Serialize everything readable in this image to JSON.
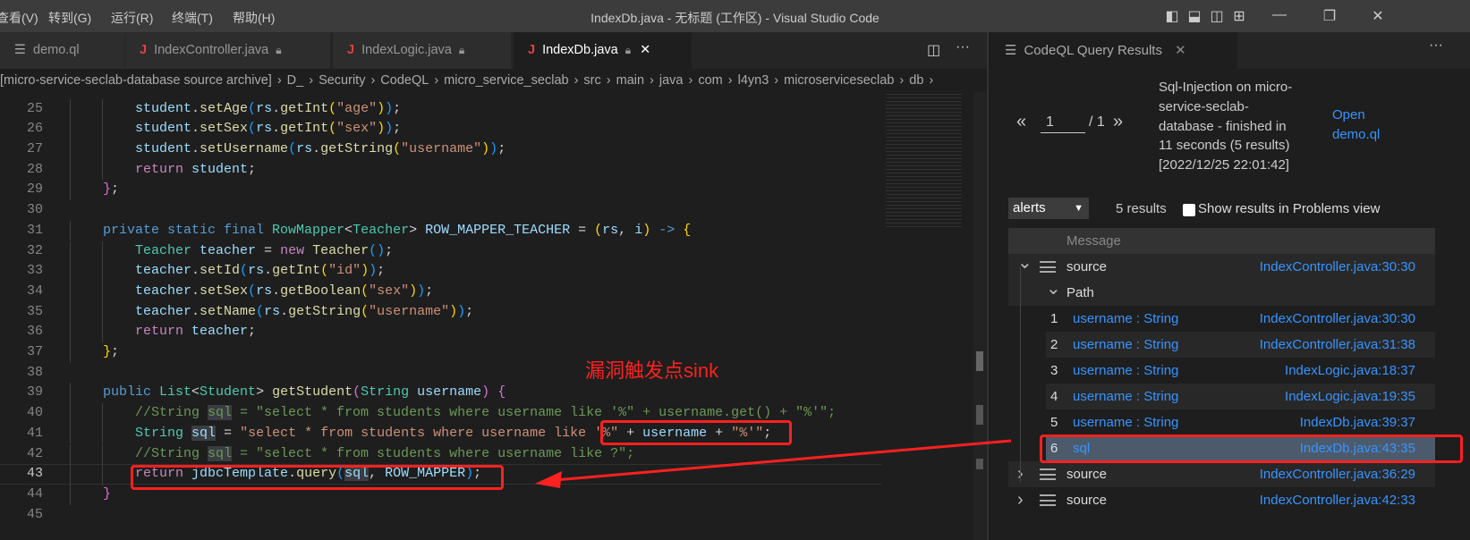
{
  "titlebar": {
    "menus": [
      "查看(V)",
      "转到(G)",
      "运行(R)",
      "终端(T)",
      "帮助(H)"
    ],
    "title": "IndexDb.java - 无标题 (工作区) - Visual Studio Code"
  },
  "tabs": [
    {
      "label": "demo.ql",
      "icon": "lines-icon",
      "locked": false,
      "active": false
    },
    {
      "label": "IndexController.java",
      "icon": "java-icon",
      "locked": true,
      "active": false
    },
    {
      "label": "IndexLogic.java",
      "icon": "java-icon",
      "locked": true,
      "active": false
    },
    {
      "label": "IndexDb.java",
      "icon": "java-icon",
      "locked": true,
      "active": true
    }
  ],
  "breadcrumb": [
    "[micro-service-seclab-database source archive]",
    "D_",
    "Security",
    "CodeQL",
    "micro_service_seclab",
    "src",
    "main",
    "java",
    "com",
    "l4yn3",
    "microserviceseclab",
    "db"
  ],
  "editor": {
    "current_line": 43,
    "lines": [
      {
        "n": 25,
        "indent": 2,
        "t": [
          [
            "va",
            "student"
          ],
          [
            "p",
            "."
          ],
          [
            "fn",
            "setAge"
          ],
          [
            "b3",
            "("
          ],
          [
            "va",
            "rs"
          ],
          [
            "p",
            "."
          ],
          [
            "fn",
            "getInt"
          ],
          [
            "b1",
            "("
          ],
          [
            "st",
            "\"age\""
          ],
          [
            "b1",
            ")"
          ],
          [
            "b3",
            ")"
          ],
          [
            "p",
            ";"
          ]
        ]
      },
      {
        "n": 26,
        "indent": 2,
        "t": [
          [
            "va",
            "student"
          ],
          [
            "p",
            "."
          ],
          [
            "fn",
            "setSex"
          ],
          [
            "b3",
            "("
          ],
          [
            "va",
            "rs"
          ],
          [
            "p",
            "."
          ],
          [
            "fn",
            "getInt"
          ],
          [
            "b1",
            "("
          ],
          [
            "st",
            "\"sex\""
          ],
          [
            "b1",
            ")"
          ],
          [
            "b3",
            ")"
          ],
          [
            "p",
            ";"
          ]
        ]
      },
      {
        "n": 27,
        "indent": 2,
        "t": [
          [
            "va",
            "student"
          ],
          [
            "p",
            "."
          ],
          [
            "fn",
            "setUsername"
          ],
          [
            "b3",
            "("
          ],
          [
            "va",
            "rs"
          ],
          [
            "p",
            "."
          ],
          [
            "fn",
            "getString"
          ],
          [
            "b1",
            "("
          ],
          [
            "st",
            "\"username\""
          ],
          [
            "b1",
            ")"
          ],
          [
            "b3",
            ")"
          ],
          [
            "p",
            ";"
          ]
        ]
      },
      {
        "n": 28,
        "indent": 2,
        "t": [
          [
            "ctl",
            "return"
          ],
          [
            "p",
            " "
          ],
          [
            "va",
            "student"
          ],
          [
            "p",
            ";"
          ]
        ]
      },
      {
        "n": 29,
        "indent": 1,
        "t": [
          [
            "b2",
            "}"
          ],
          [
            "p",
            ";"
          ]
        ]
      },
      {
        "n": 30,
        "indent": 0,
        "t": []
      },
      {
        "n": 31,
        "indent": 1,
        "t": [
          [
            "kw",
            "private static final "
          ],
          [
            "ty",
            "RowMapper"
          ],
          [
            "p",
            "<"
          ],
          [
            "ty",
            "Teacher"
          ],
          [
            "p",
            "> "
          ],
          [
            "va",
            "ROW_MAPPER_TEACHER"
          ],
          [
            "p",
            " = "
          ],
          [
            "b1",
            "("
          ],
          [
            "va",
            "rs"
          ],
          [
            "p",
            ", "
          ],
          [
            "va",
            "i"
          ],
          [
            "b1",
            ")"
          ],
          [
            "p",
            " "
          ],
          [
            "kw",
            "->"
          ],
          [
            "p",
            " "
          ],
          [
            "b1",
            "{"
          ]
        ]
      },
      {
        "n": 32,
        "indent": 2,
        "t": [
          [
            "ty",
            "Teacher"
          ],
          [
            "p",
            " "
          ],
          [
            "va",
            "teacher"
          ],
          [
            "p",
            " = "
          ],
          [
            "ctl",
            "new"
          ],
          [
            "p",
            " "
          ],
          [
            "fn",
            "Teacher"
          ],
          [
            "b3",
            "()"
          ],
          [
            "p",
            ";"
          ]
        ]
      },
      {
        "n": 33,
        "indent": 2,
        "t": [
          [
            "va",
            "teacher"
          ],
          [
            "p",
            "."
          ],
          [
            "fn",
            "setId"
          ],
          [
            "b3",
            "("
          ],
          [
            "va",
            "rs"
          ],
          [
            "p",
            "."
          ],
          [
            "fn",
            "getInt"
          ],
          [
            "b1",
            "("
          ],
          [
            "st",
            "\"id\""
          ],
          [
            "b1",
            ")"
          ],
          [
            "b3",
            ")"
          ],
          [
            "p",
            ";"
          ]
        ]
      },
      {
        "n": 34,
        "indent": 2,
        "t": [
          [
            "va",
            "teacher"
          ],
          [
            "p",
            "."
          ],
          [
            "fn",
            "setSex"
          ],
          [
            "b3",
            "("
          ],
          [
            "va",
            "rs"
          ],
          [
            "p",
            "."
          ],
          [
            "fn",
            "getBoolean"
          ],
          [
            "b1",
            "("
          ],
          [
            "st",
            "\"sex\""
          ],
          [
            "b1",
            ")"
          ],
          [
            "b3",
            ")"
          ],
          [
            "p",
            ";"
          ]
        ]
      },
      {
        "n": 35,
        "indent": 2,
        "t": [
          [
            "va",
            "teacher"
          ],
          [
            "p",
            "."
          ],
          [
            "fn",
            "setName"
          ],
          [
            "b3",
            "("
          ],
          [
            "va",
            "rs"
          ],
          [
            "p",
            "."
          ],
          [
            "fn",
            "getString"
          ],
          [
            "b1",
            "("
          ],
          [
            "st",
            "\"username\""
          ],
          [
            "b1",
            ")"
          ],
          [
            "b3",
            ")"
          ],
          [
            "p",
            ";"
          ]
        ]
      },
      {
        "n": 36,
        "indent": 2,
        "t": [
          [
            "ctl",
            "return"
          ],
          [
            "p",
            " "
          ],
          [
            "va",
            "teacher"
          ],
          [
            "p",
            ";"
          ]
        ]
      },
      {
        "n": 37,
        "indent": 1,
        "t": [
          [
            "b1",
            "}"
          ],
          [
            "p",
            ";"
          ]
        ]
      },
      {
        "n": 38,
        "indent": 0,
        "t": []
      },
      {
        "n": 39,
        "indent": 1,
        "t": [
          [
            "kw",
            "public "
          ],
          [
            "ty",
            "List"
          ],
          [
            "p",
            "<"
          ],
          [
            "ty",
            "Student"
          ],
          [
            "p",
            "> "
          ],
          [
            "fn",
            "getStudent"
          ],
          [
            "b2",
            "("
          ],
          [
            "ty",
            "String"
          ],
          [
            "p",
            " "
          ],
          [
            "va",
            "username"
          ],
          [
            "b2",
            ")"
          ],
          [
            "p",
            " "
          ],
          [
            "b2",
            "{"
          ]
        ]
      },
      {
        "n": 40,
        "indent": 2,
        "t": [
          [
            "cm",
            "//String "
          ],
          [
            "cm hl",
            "sql"
          ],
          [
            "cm",
            " = \"select * from students where username like '%\" + username.get() + \"%'\";"
          ]
        ]
      },
      {
        "n": 41,
        "indent": 2,
        "t": [
          [
            "ty",
            "String"
          ],
          [
            "p",
            " "
          ],
          [
            "va hl",
            "sql"
          ],
          [
            "p",
            " = "
          ],
          [
            "st",
            "\"select * from students where username like '%\""
          ],
          [
            "p",
            " + "
          ],
          [
            "va",
            "username"
          ],
          [
            "p",
            " + "
          ],
          [
            "st",
            "\"%'\""
          ],
          [
            "p",
            ";"
          ]
        ]
      },
      {
        "n": 42,
        "indent": 2,
        "t": [
          [
            "cm",
            "//String "
          ],
          [
            "cm hl",
            "sql"
          ],
          [
            "cm",
            " = \"select * from students where username like ?\";"
          ]
        ]
      },
      {
        "n": 43,
        "indent": 2,
        "t": [
          [
            "ctl",
            "return"
          ],
          [
            "p",
            " "
          ],
          [
            "va",
            "jdbcTemplate"
          ],
          [
            "p",
            "."
          ],
          [
            "fn",
            "query"
          ],
          [
            "b3",
            "("
          ],
          [
            "va hl",
            "sql"
          ],
          [
            "p",
            ", "
          ],
          [
            "va",
            "ROW_MAPPER"
          ],
          [
            "b3",
            ")"
          ],
          [
            "p",
            ";"
          ]
        ]
      },
      {
        "n": 44,
        "indent": 1,
        "t": [
          [
            "b2",
            "}"
          ]
        ]
      },
      {
        "n": 45,
        "indent": 0,
        "t": []
      }
    ]
  },
  "annotation": {
    "label": "漏洞触发点sink",
    "color": "#ff2020"
  },
  "panel": {
    "tab_label": "CodeQL Query Results",
    "page_input": "1",
    "page_total": "/ 1",
    "prev": "«",
    "next": "»",
    "description": [
      "Sql-Injection on micro-",
      "service-seclab-",
      "database - finished in",
      "11 seconds (5 results)",
      "[2022/12/25 22:01:42]"
    ],
    "open_link": [
      "Open",
      "demo.ql"
    ],
    "select_value": "alerts",
    "result_count": "5 results",
    "problems_label": "Show results in Problems view",
    "problems_checked": false,
    "header": "Message",
    "rows": [
      {
        "type": "source",
        "expanded": true,
        "label": "source",
        "loc": "IndexController.java:30:30"
      },
      {
        "type": "path",
        "expanded": true,
        "label": "Path"
      },
      {
        "type": "step",
        "num": "1",
        "label": "username : String",
        "loc": "IndexController.java:30:30"
      },
      {
        "type": "step",
        "num": "2",
        "label": "username : String",
        "loc": "IndexController.java:31:38"
      },
      {
        "type": "step",
        "num": "3",
        "label": "username : String",
        "loc": "IndexLogic.java:18:37"
      },
      {
        "type": "step",
        "num": "4",
        "label": "username : String",
        "loc": "IndexLogic.java:19:35"
      },
      {
        "type": "step",
        "num": "5",
        "label": "username : String",
        "loc": "IndexDb.java:39:37"
      },
      {
        "type": "step",
        "num": "6",
        "label": "sql",
        "loc": "IndexDb.java:43:35",
        "selected": true
      },
      {
        "type": "source",
        "expanded": false,
        "label": "source",
        "loc": "IndexController.java:36:29"
      },
      {
        "type": "source",
        "expanded": false,
        "label": "source",
        "loc": "IndexController.java:42:33"
      }
    ]
  }
}
